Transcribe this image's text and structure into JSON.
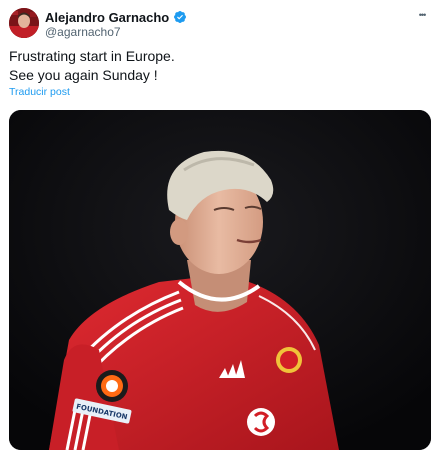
{
  "author": {
    "display_name": "Alejandro Garnacho",
    "handle": "@agarnacho7",
    "verified_icon": "verified-badge-icon",
    "verified_color": "#1d9bf0"
  },
  "tweet": {
    "text_lines": [
      "Frustrating start in Europe.",
      "See you again Sunday !"
    ],
    "translate_label": "Traducir post",
    "more_label": "•••"
  },
  "media": {
    "armband_text": "FOUNDATION",
    "colors": {
      "kit_red": "#d0202a",
      "background": "#0c0c0e",
      "hair": "#d9d4c6",
      "skin": "#e2b49c"
    }
  },
  "colors": {
    "link": "#1d9bf0",
    "secondary_text": "#536471",
    "primary_text": "#0f1419"
  }
}
